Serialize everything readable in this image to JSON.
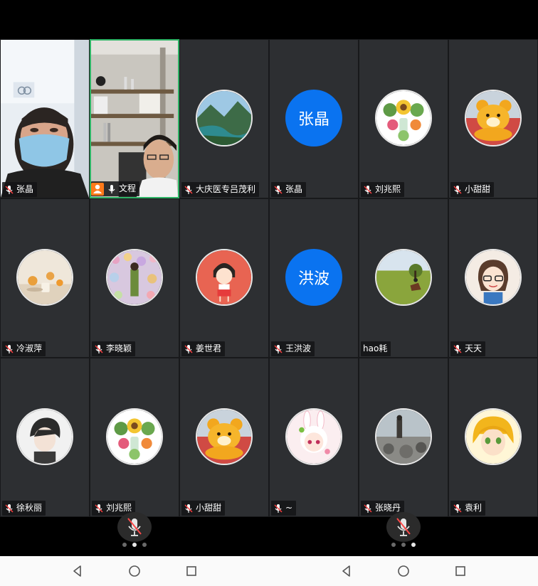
{
  "left_panel": {
    "tiles": [
      {
        "name": "张晶"
      },
      {
        "name": "文程"
      },
      {
        "name": "大庆医专吕茂利"
      },
      {
        "name": "冷淑萍"
      },
      {
        "name": "李晓颖"
      },
      {
        "name": "姜世君"
      },
      {
        "name": "徐秋丽"
      },
      {
        "name": "刘兆熙"
      },
      {
        "name": "小甜甜"
      }
    ]
  },
  "right_panel": {
    "tiles": [
      {
        "name": "张晶",
        "avatar_text": "张晶"
      },
      {
        "name": "刘兆熙"
      },
      {
        "name": "小甜甜"
      },
      {
        "name": "王洪波",
        "avatar_text": "洪波"
      },
      {
        "name": "hao耗"
      },
      {
        "name": "天天"
      },
      {
        "name": "~"
      },
      {
        "name": "张晓丹"
      },
      {
        "name": "袁利"
      }
    ]
  },
  "icons": {
    "mic": "mic-icon",
    "mic_muted": "mic-muted-icon",
    "host": "host-person-icon",
    "back": "back-triangle-icon",
    "home": "home-circle-icon",
    "recents": "recents-square-icon"
  },
  "colors": {
    "tile_bg": "#2d2f32",
    "text_avatar_bg": "#0a73f0",
    "active_border": "#2fb466",
    "host_badge": "#ff7a1a"
  },
  "pagination": {
    "left_active_page": 2,
    "right_active_page": 3,
    "total_pages": 3
  }
}
